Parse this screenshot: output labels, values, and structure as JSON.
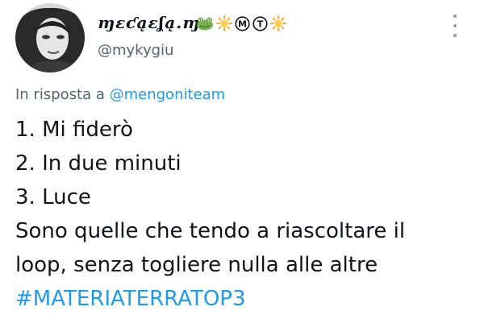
{
  "author": {
    "display_name": "ɱɛƈąɛʆą.ɱ.",
    "handle": "@mykygiu",
    "name_icons": [
      "frog-icon",
      "sun-icon",
      "circled-m-icon",
      "circled-t-icon",
      "sun-icon"
    ],
    "name_icon_letters": {
      "circled-m-icon": "M",
      "circled-t-icon": "T"
    }
  },
  "reply_to": {
    "prefix": "In risposta a",
    "mention": "@mengoniteam"
  },
  "tweet": {
    "lines": [
      "1. Mi fiderò",
      "2. In due minuti",
      "3. Luce",
      "Sono quelle che tendo a riascoltare il",
      "loop, senza togliere nulla alle altre"
    ],
    "hashtag": "#MATERIATERRATOP3"
  },
  "colors": {
    "link": "#1d9bf0",
    "text": "#0f1419",
    "secondary": "#536471",
    "background": "#ffffff"
  }
}
